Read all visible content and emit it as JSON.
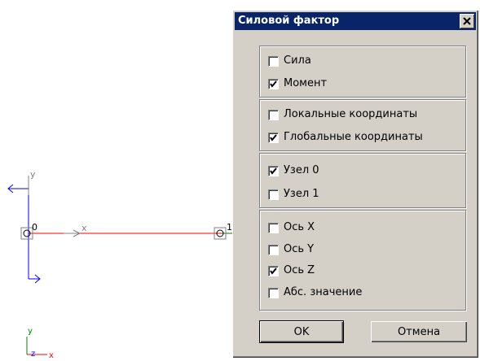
{
  "viewport": {
    "axis_y_label": "y",
    "axis_x_label": "x",
    "node0_label": "0",
    "node1_label": "1",
    "triad_y": "y",
    "triad_z": "z",
    "triad_x": "x"
  },
  "dialog": {
    "title": "Силовой фактор",
    "close_glyph": "✕",
    "groups": {
      "factor": [
        {
          "label": "Сила",
          "checked": false
        },
        {
          "label": "Момент",
          "checked": true
        }
      ],
      "coords": [
        {
          "label": "Локальные координаты",
          "checked": false
        },
        {
          "label": "Глобальные координаты",
          "checked": true
        }
      ],
      "nodes": [
        {
          "label": "Узел 0",
          "checked": true
        },
        {
          "label": "Узел 1",
          "checked": false
        }
      ],
      "axes": [
        {
          "label": "Ось X",
          "checked": false
        },
        {
          "label": "Ось Y",
          "checked": false
        },
        {
          "label": "Ось Z",
          "checked": true
        },
        {
          "label": "Абс. значение",
          "checked": false
        }
      ]
    },
    "ok_label": "OK",
    "cancel_label": "Отмена"
  },
  "colors": {
    "beam": "#ff0000",
    "axis_blue": "#0000ff",
    "axis_green": "#008000",
    "title_bar": "#0a246a"
  }
}
